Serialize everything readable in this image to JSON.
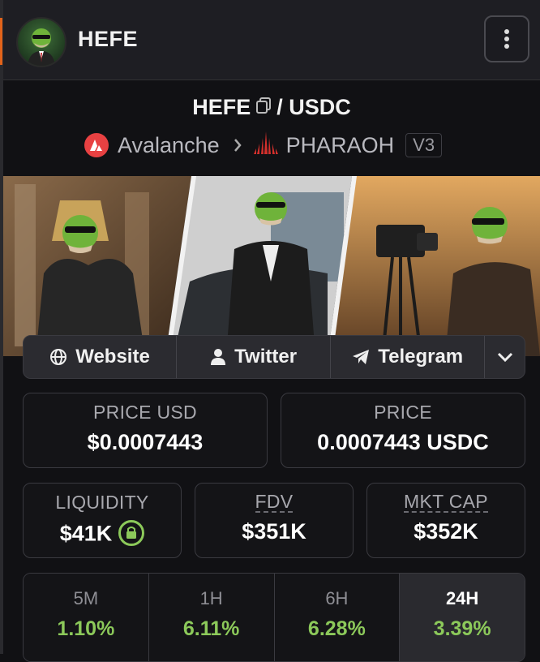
{
  "header": {
    "token_name": "HEFE"
  },
  "pair": {
    "base": "HEFE",
    "separator": "/",
    "quote": "USDC"
  },
  "chain": {
    "name": "Avalanche",
    "dex": "PHARAOH",
    "version": "V3"
  },
  "links": {
    "website": "Website",
    "twitter": "Twitter",
    "telegram": "Telegram"
  },
  "stats": {
    "price_usd": {
      "label": "PRICE USD",
      "value": "$0.0007443"
    },
    "price": {
      "label": "PRICE",
      "value": "0.0007443 USDC"
    },
    "liquidity": {
      "label": "LIQUIDITY",
      "value": "$41K"
    },
    "fdv": {
      "label": "FDV",
      "value": "$351K"
    },
    "mkt_cap": {
      "label": "MKT CAP",
      "value": "$352K"
    }
  },
  "timeframes": [
    {
      "label": "5M",
      "change": "1.10%"
    },
    {
      "label": "1H",
      "change": "6.11%"
    },
    {
      "label": "6H",
      "change": "6.28%"
    },
    {
      "label": "24H",
      "change": "3.39%"
    }
  ],
  "colors": {
    "accent": "#e2631a",
    "positive": "#8cc95a",
    "avalanche": "#e84142",
    "pharaoh": "#d4302c"
  },
  "icons": [
    "copy-icon",
    "avalanche-icon",
    "chevron-right-icon",
    "pharaoh-icon",
    "globe-icon",
    "user-icon",
    "telegram-icon",
    "chevron-down-icon",
    "lock-icon",
    "kebab-menu-icon"
  ]
}
